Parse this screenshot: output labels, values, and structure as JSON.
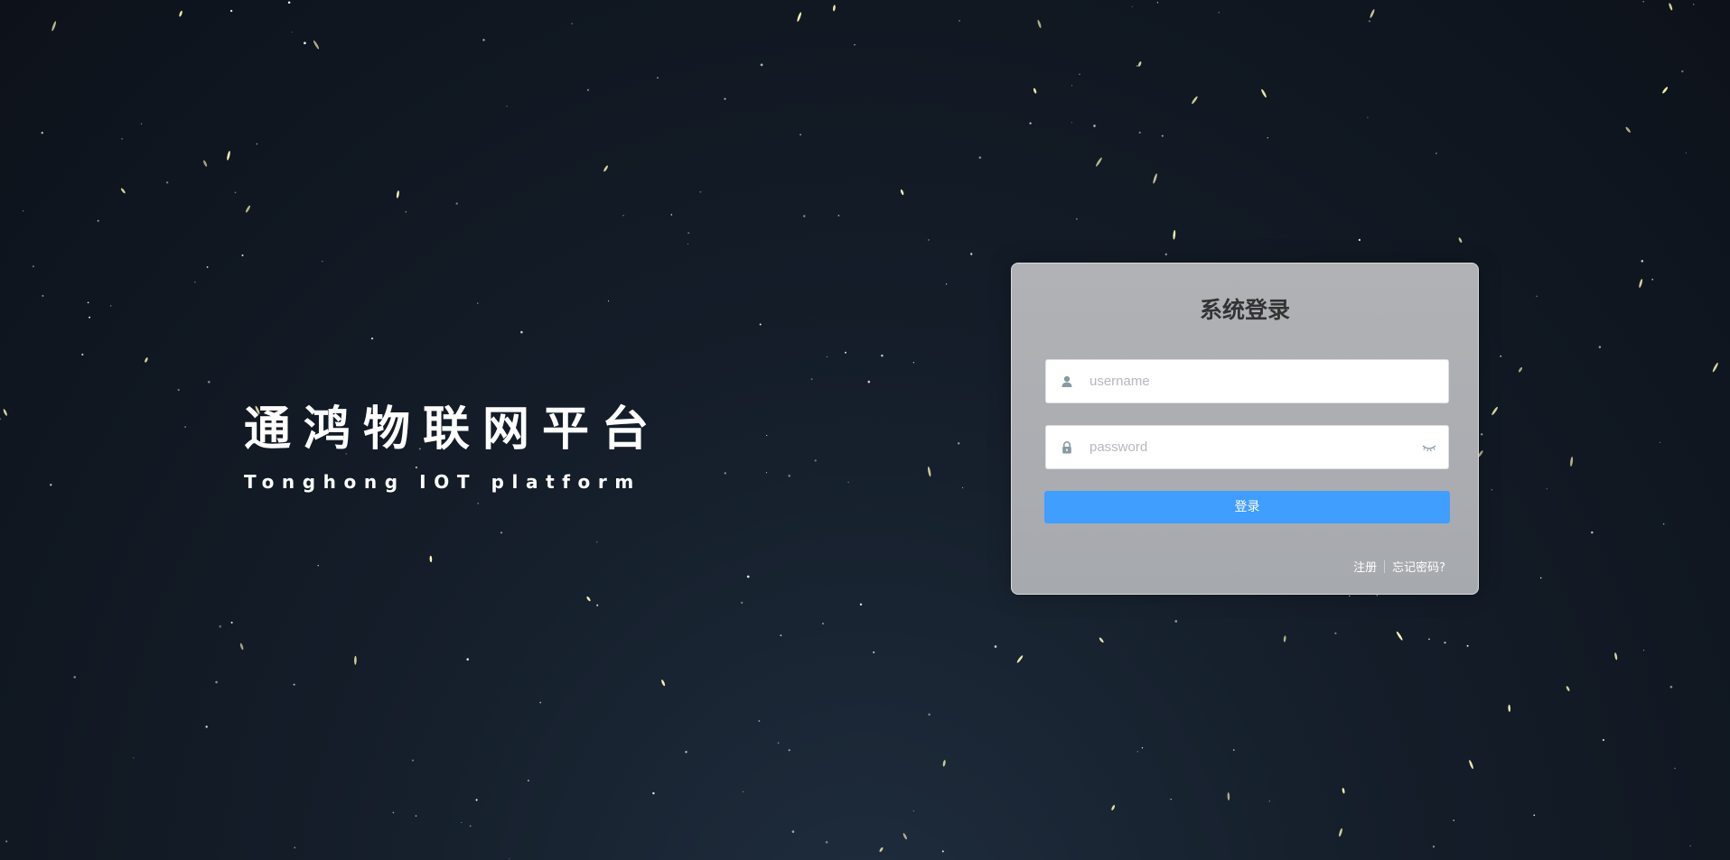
{
  "brand": {
    "title": "通鸿物联网平台",
    "subtitle": "Tonghong IOT platform"
  },
  "login": {
    "title": "系统登录",
    "username": {
      "value": "",
      "placeholder": "username",
      "icon": "user-icon"
    },
    "password": {
      "value": "",
      "placeholder": "password",
      "icon": "lock-icon",
      "toggle_icon": "eye-closed-icon"
    },
    "submit_label": "登录",
    "register_label": "注册",
    "forgot_label": "忘记密码?"
  },
  "colors": {
    "primary": "#409eff",
    "background": "#0d121a",
    "card": "#acaeb2",
    "star_white": "#ffffff",
    "star_yellow": "#fffbb8"
  }
}
